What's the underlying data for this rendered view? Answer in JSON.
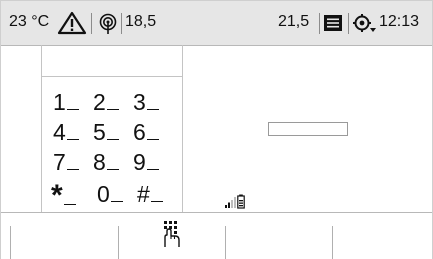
{
  "status_bar": {
    "temperature": "23 °C",
    "left_reading": "18,5",
    "right_reading": "21,5",
    "time": "12:13",
    "icons": [
      "warning-icon",
      "radio-broadcast-icon",
      "message-icon",
      "settings-icon"
    ]
  },
  "keypad": {
    "keys": [
      "1",
      "2",
      "3",
      "4",
      "5",
      "6",
      "7",
      "8",
      "9",
      "*",
      "0",
      "#"
    ]
  },
  "number_field": {
    "value": ""
  },
  "indicators": [
    "signal-strength-icon",
    "battery-icon"
  ],
  "toolbar": {
    "icons": [
      "keypad-touch-icon"
    ]
  },
  "colors": {
    "status_background": "#e6e6e6",
    "screen_background": "#ffffff",
    "text": "#111111",
    "divider": "#b8b8b8"
  }
}
